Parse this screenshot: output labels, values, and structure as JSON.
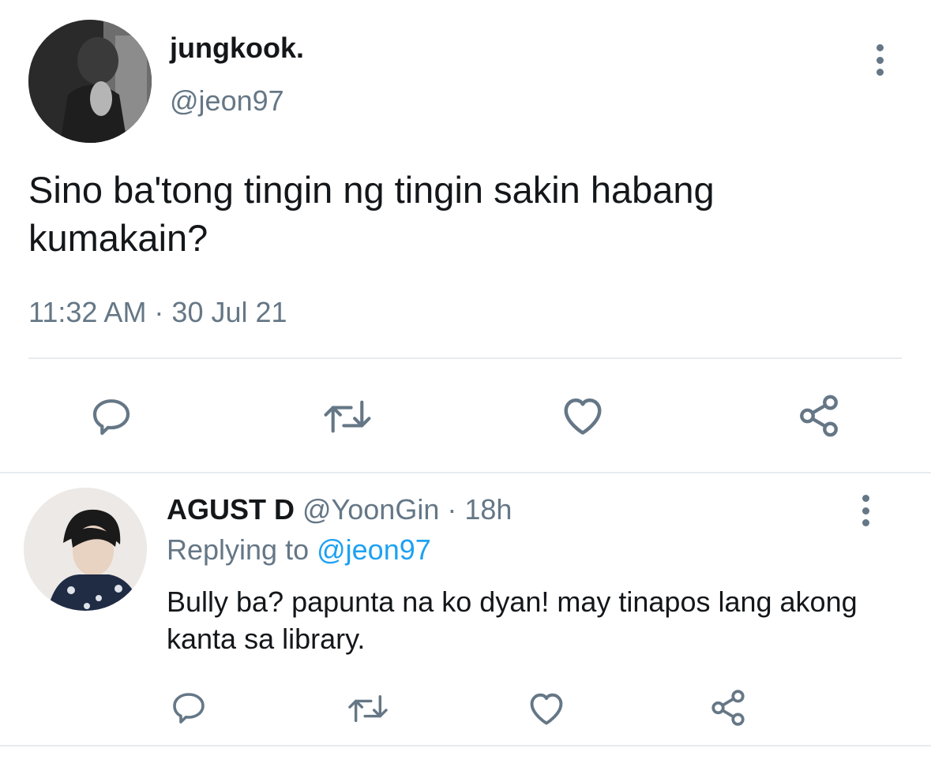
{
  "main_tweet": {
    "display_name": "jungkook.",
    "handle": "@jeon97",
    "text": "Sino ba'tong tingin ng tingin sakin habang kumakain?",
    "timestamp": "11:32 AM · 30 Jul 21",
    "actions": {
      "reply_icon": "comment-icon",
      "retweet_icon": "retweet-icon",
      "like_icon": "heart-icon",
      "share_icon": "share-icon"
    }
  },
  "reply": {
    "display_name": "AGUST D",
    "handle": "@YoonGin",
    "separator": " · ",
    "age": "18h",
    "replying_prefix": "Replying to ",
    "replying_handle": "@jeon97",
    "text": "Bully ba? papunta na ko dyan! may tinapos lang akong kanta sa library."
  },
  "colors": {
    "primary_text": "#14171a",
    "secondary_text": "#657786",
    "link": "#1da1f2",
    "divider": "#e6ecf0"
  }
}
